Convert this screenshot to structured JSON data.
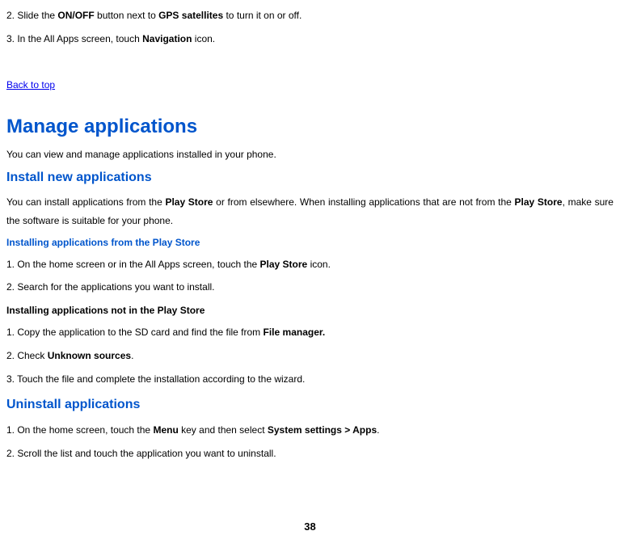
{
  "topSteps": {
    "s2_pre": "2. Slide the ",
    "s2_b1": "ON/OFF",
    "s2_mid": " button next to ",
    "s2_b2": "GPS satellites",
    "s2_post": " to turn it on or off.",
    "s3_pre": "3. In the All Apps screen, touch ",
    "s3_b1": "Navigation",
    "s3_post": " icon."
  },
  "backToTop": "Back to top",
  "h1": "Manage applications",
  "intro": "You can view and manage applications installed in your phone.",
  "install": {
    "h2": "Install new applications",
    "p_pre": "You can install applications from the ",
    "p_b1": "Play Store",
    "p_mid": " or from elsewhere. When installing applications that are not from the ",
    "p_b2": "Play Store",
    "p_post": ", make sure the software is suitable for your phone.",
    "fromStore": {
      "h3": "Installing applications from the Play Store",
      "s1_pre": "1. On the home screen or in the All Apps screen, touch the ",
      "s1_b1": "Play Store",
      "s1_post": " icon.",
      "s2": "2. Search for the applications you want to install."
    },
    "notStore": {
      "h4": "Installing applications not in the Play Store",
      "s1_pre": "1. Copy the application to the SD card and find the file from ",
      "s1_b1": "File manager.",
      "s2_pre": "2. Check ",
      "s2_b1": "Unknown sources",
      "s2_post": ".",
      "s3": "3. Touch the file and complete the installation according to the wizard."
    }
  },
  "uninstall": {
    "h2": "Uninstall applications",
    "s1_pre": "1. On the home screen, touch the ",
    "s1_b1": "Menu",
    "s1_mid": " key and then select ",
    "s1_b2": "System settings > Apps",
    "s1_post": ".",
    "s2": "2. Scroll the list and touch the application you want to uninstall."
  },
  "pageNumber": "38"
}
